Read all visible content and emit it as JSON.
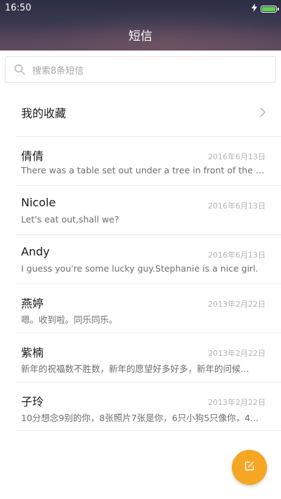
{
  "status_bar": {
    "time": "16:50",
    "battery_level": 1.0,
    "battery_color": "#5fd34a"
  },
  "header": {
    "title": "短信"
  },
  "search": {
    "placeholder": "搜索8条短信"
  },
  "favorites": {
    "label": "我的收藏"
  },
  "conversations": [
    {
      "name": "倩倩",
      "date": "2016年6月13日",
      "preview": "There was a table set out under a tree in front of the ho..."
    },
    {
      "name": "Nicole",
      "date": "2016年6月13日",
      "preview": "Let's eat out,shall we?"
    },
    {
      "name": "Andy",
      "date": "2016年6月13日",
      "preview": "I guess you're some lucky guy.Stephanie is a nice girl."
    },
    {
      "name": "燕婷",
      "date": "2013年2月22日",
      "preview": "嗯。收到啦。同乐同乐。"
    },
    {
      "name": "紫楠",
      "date": "2013年2月22日",
      "preview": "新年的祝福数不胜数，新年的愿望好多好多，新年的问候..."
    },
    {
      "name": "子玲",
      "date": "2013年2月22日",
      "preview": "10分想念9别的你，8张照片7张是你，6只小狗5只像你，4..."
    }
  ],
  "fab": {
    "icon": "compose-icon",
    "color": "#f5a623"
  }
}
